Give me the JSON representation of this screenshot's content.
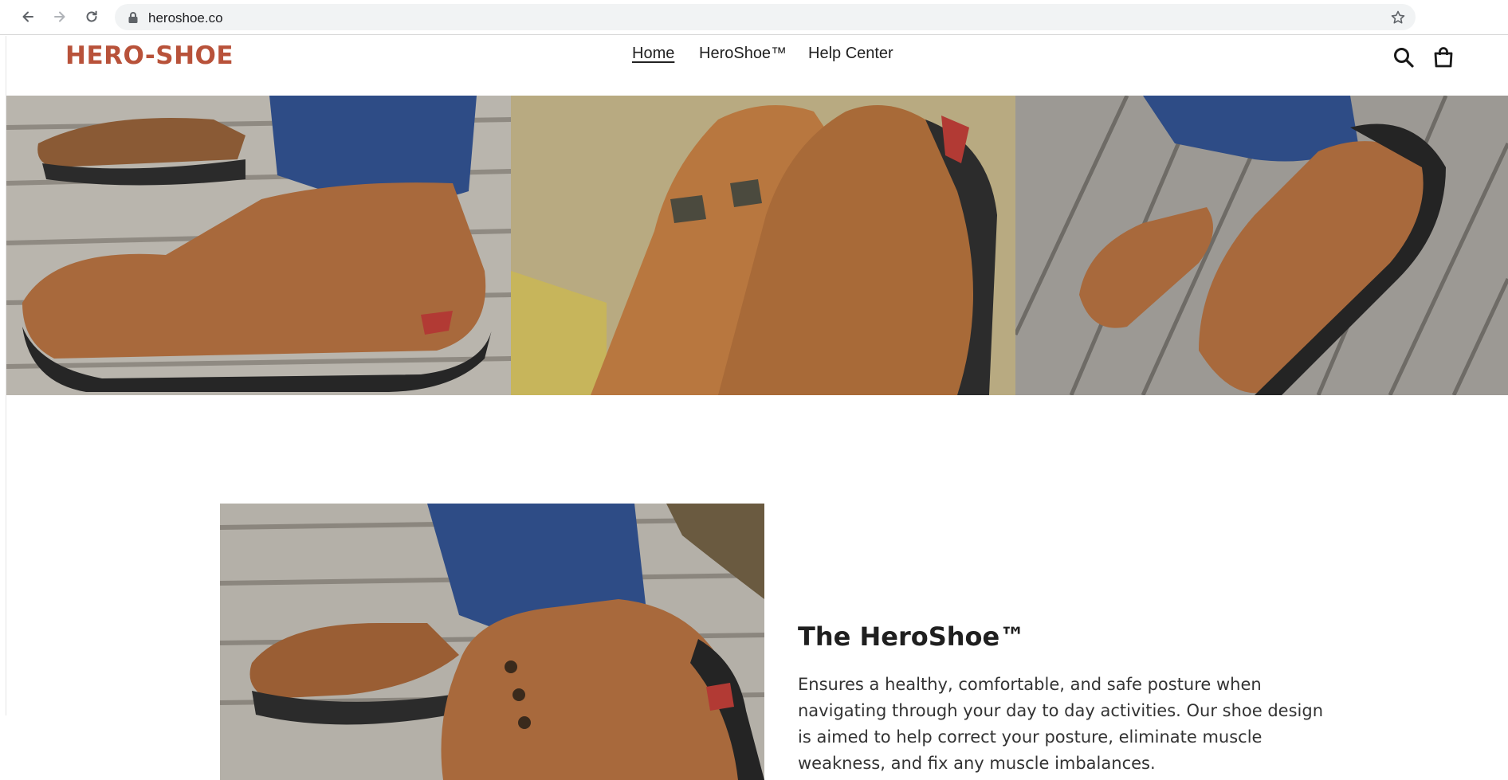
{
  "browser": {
    "url": "heroshoe.co",
    "icons": {
      "back": "back-arrow-icon",
      "forward": "forward-arrow-icon",
      "reload": "reload-icon",
      "lock": "lock-icon",
      "bookmark": "star-icon"
    }
  },
  "site": {
    "logo_text": "HERO-SHOE",
    "brand_color": "#b8523a",
    "nav": [
      {
        "label": "Home",
        "active": true
      },
      {
        "label": "HeroShoe™",
        "active": false
      },
      {
        "label": "Help Center",
        "active": false
      }
    ],
    "header_icons": [
      "search-icon",
      "cart-icon"
    ]
  },
  "hero": {
    "images": [
      "shoe-side-on-deck-photo",
      "shoe-pair-closeup-photo",
      "shoe-aerial-on-deck-photo"
    ]
  },
  "feature": {
    "image": "lace-up-shoe-photo",
    "title": "The HeroShoe™",
    "description": "Ensures a healthy, comfortable, and safe posture when navigating through your day to day activities. Our shoe design is aimed to help correct your posture, eliminate muscle weakness, and fix any muscle imbalances."
  }
}
